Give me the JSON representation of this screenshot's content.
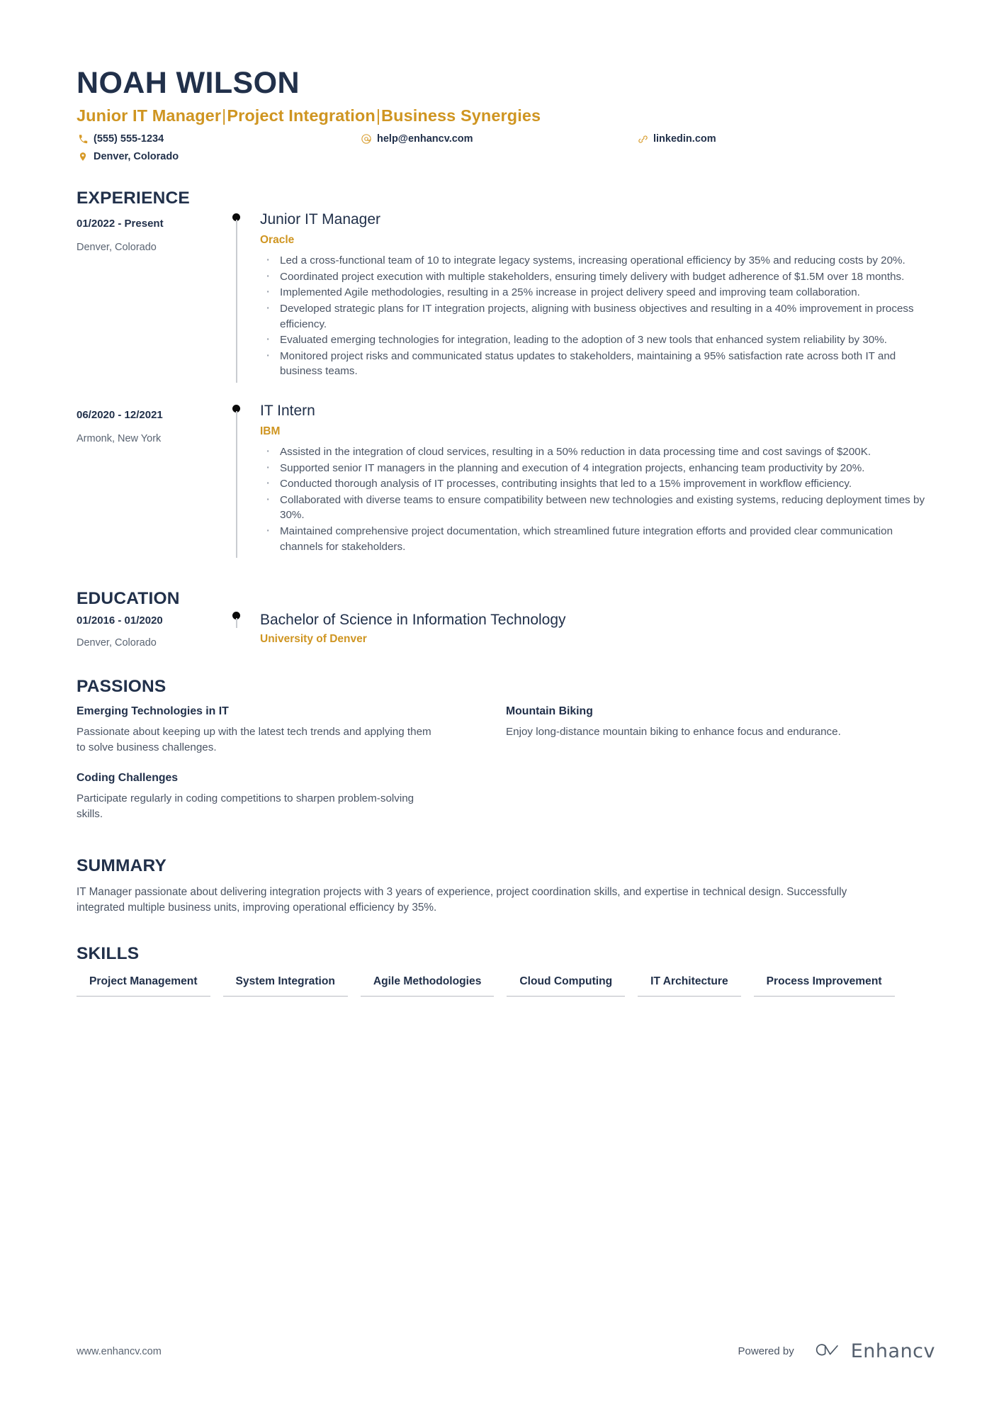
{
  "header": {
    "name": "NOAH WILSON",
    "headline_parts": [
      "Junior IT Manager",
      "Project Integration",
      "Business Synergies"
    ],
    "headline_separator": "|",
    "contacts": [
      {
        "icon": "phone-icon",
        "text": "(555) 555-1234"
      },
      {
        "icon": "email-icon",
        "text": "help@enhancv.com"
      },
      {
        "icon": "link-icon",
        "text": "linkedin.com"
      },
      {
        "icon": "location-pin-icon",
        "text": "Denver, Colorado"
      }
    ]
  },
  "sections": {
    "experience_title": "EXPERIENCE",
    "education_title": "EDUCATION",
    "passions_title": "PASSIONS",
    "summary_title": "SUMMARY",
    "skills_title": "SKILLS"
  },
  "experience": [
    {
      "date": "01/2022 - Present",
      "location": "Denver, Colorado",
      "title": "Junior IT Manager",
      "company": "Oracle",
      "bullets": [
        "Led a cross-functional team of 10 to integrate legacy systems, increasing operational efficiency by 35% and reducing costs by 20%.",
        "Coordinated project execution with multiple stakeholders, ensuring timely delivery with budget adherence of $1.5M over 18 months.",
        "Implemented Agile methodologies, resulting in a 25% increase in project delivery speed and improving team collaboration.",
        "Developed strategic plans for IT integration projects, aligning with business objectives and resulting in a 40% improvement in process efficiency.",
        "Evaluated emerging technologies for integration, leading to the adoption of 3 new tools that enhanced system reliability by 30%.",
        "Monitored project risks and communicated status updates to stakeholders, maintaining a 95% satisfaction rate across both IT and business teams."
      ]
    },
    {
      "date": "06/2020 - 12/2021",
      "location": "Armonk, New York",
      "title": "IT Intern",
      "company": "IBM",
      "bullets": [
        "Assisted in the integration of cloud services, resulting in a 50% reduction in data processing time and cost savings of $200K.",
        "Supported senior IT managers in the planning and execution of 4 integration projects, enhancing team productivity by 20%.",
        "Conducted thorough analysis of IT processes, contributing insights that led to a 15% improvement in workflow efficiency.",
        "Collaborated with diverse teams to ensure compatibility between new technologies and existing systems, reducing deployment times by 30%.",
        "Maintained comprehensive project documentation, which streamlined future integration efforts and provided clear communication channels for stakeholders."
      ]
    }
  ],
  "education": [
    {
      "date": "01/2016 - 01/2020",
      "location": "Denver, Colorado",
      "degree": "Bachelor of Science in Information Technology",
      "school": "University of Denver"
    }
  ],
  "passions": [
    {
      "title": "Emerging Technologies in IT",
      "description": "Passionate about keeping up with the latest tech trends and applying them to solve business challenges."
    },
    {
      "title": "Mountain Biking",
      "description": "Enjoy long-distance mountain biking to enhance focus and endurance."
    },
    {
      "title": "Coding Challenges",
      "description": "Participate regularly in coding competitions to sharpen problem-solving skills."
    }
  ],
  "summary": "IT Manager passionate about delivering integration projects with 3 years of experience, project coordination skills, and expertise in technical design. Successfully integrated multiple business units, improving operational efficiency by 35%.",
  "skills": [
    "Project Management",
    "System Integration",
    "Agile Methodologies",
    "Cloud Computing",
    "IT Architecture",
    "Process Improvement"
  ],
  "footer": {
    "url": "www.enhancv.com",
    "powered_by": "Powered by",
    "brand": "Enhancv"
  },
  "colors": {
    "navy": "#21304a",
    "gold": "#cf9521",
    "body_text": "#4a5464",
    "muted": "#5a6472",
    "rule": "#b9bcc2"
  }
}
